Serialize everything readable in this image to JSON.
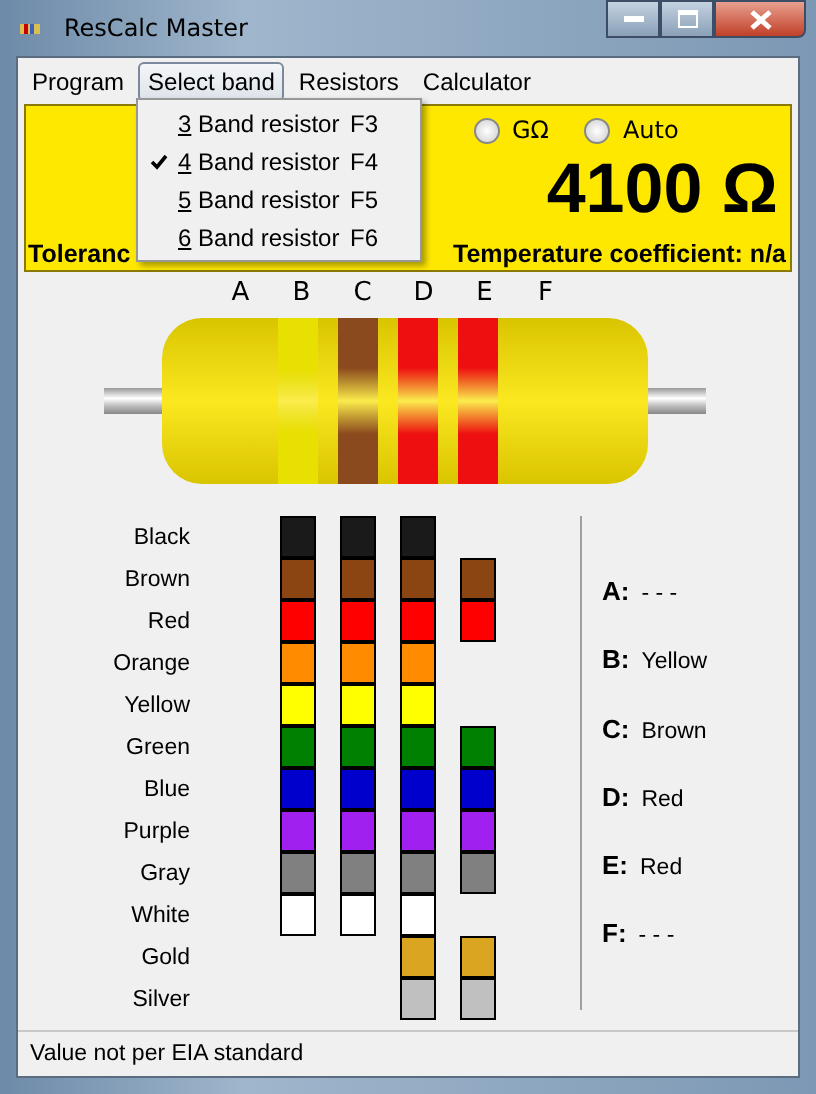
{
  "window": {
    "title": "ResCalc Master"
  },
  "menu_bar": [
    {
      "label": "Program",
      "selected": false
    },
    {
      "label": "Select band",
      "selected": true
    },
    {
      "label": "Resistors",
      "selected": false
    },
    {
      "label": "Calculator",
      "selected": false
    }
  ],
  "dropdown": [
    {
      "label": "3 Band resistor",
      "shortcut": "F3",
      "checked": false
    },
    {
      "label": "4 Band resistor",
      "shortcut": "F4",
      "checked": true
    },
    {
      "label": "5 Band resistor",
      "shortcut": "F5",
      "checked": false
    },
    {
      "label": "6 Band resistor",
      "shortcut": "F6",
      "checked": false
    }
  ],
  "display": {
    "units": [
      {
        "label": "GΩ",
        "selected": false
      },
      {
        "label": "Auto",
        "selected": false
      }
    ],
    "value": "4100 Ω",
    "tolerance_label": "Toleranc",
    "temperature": "Temperature coefficient: n/a"
  },
  "resistor": {
    "bands": [
      {
        "letter": "A"
      },
      {
        "letter": "B",
        "color": "#e8e000"
      },
      {
        "letter": "C",
        "color": "#8b4a1e"
      },
      {
        "letter": "D",
        "color": "#ee1010"
      },
      {
        "letter": "E",
        "color": "#ee1010"
      },
      {
        "letter": "F"
      }
    ]
  },
  "color_rows": [
    {
      "label": "Black",
      "color": "#1a1a1a",
      "shown": [
        true,
        true,
        true,
        false
      ]
    },
    {
      "label": "Brown",
      "color": "#8b4513",
      "shown": [
        true,
        true,
        true,
        true
      ]
    },
    {
      "label": "Red",
      "color": "#ff0000",
      "shown": [
        true,
        true,
        true,
        true
      ]
    },
    {
      "label": "Orange",
      "color": "#ff8c00",
      "shown": [
        true,
        true,
        true,
        false
      ]
    },
    {
      "label": "Yellow",
      "color": "#ffff00",
      "shown": [
        true,
        true,
        true,
        false
      ]
    },
    {
      "label": "Green",
      "color": "#008000",
      "shown": [
        true,
        true,
        true,
        true
      ]
    },
    {
      "label": "Blue",
      "color": "#0000cd",
      "shown": [
        true,
        true,
        true,
        true
      ]
    },
    {
      "label": "Purple",
      "color": "#a020f0",
      "shown": [
        true,
        true,
        true,
        true
      ]
    },
    {
      "label": "Gray",
      "color": "#808080",
      "shown": [
        true,
        true,
        true,
        true
      ]
    },
    {
      "label": "White",
      "color": "#ffffff",
      "shown": [
        true,
        true,
        true,
        false
      ]
    },
    {
      "label": "Gold",
      "color": "#daa520",
      "shown": [
        false,
        false,
        true,
        true
      ]
    },
    {
      "label": "Silver",
      "color": "#c0c0c0",
      "shown": [
        false,
        false,
        true,
        true
      ]
    }
  ],
  "results": [
    {
      "letter": "A:",
      "value": "- - -"
    },
    {
      "letter": "B:",
      "value": "Yellow"
    },
    {
      "letter": "C:",
      "value": "Brown"
    },
    {
      "letter": "D:",
      "value": "Red"
    },
    {
      "letter": "E:",
      "value": "Red"
    },
    {
      "letter": "F:",
      "value": "- - -"
    }
  ],
  "status_bar": "Value not per EIA standard"
}
